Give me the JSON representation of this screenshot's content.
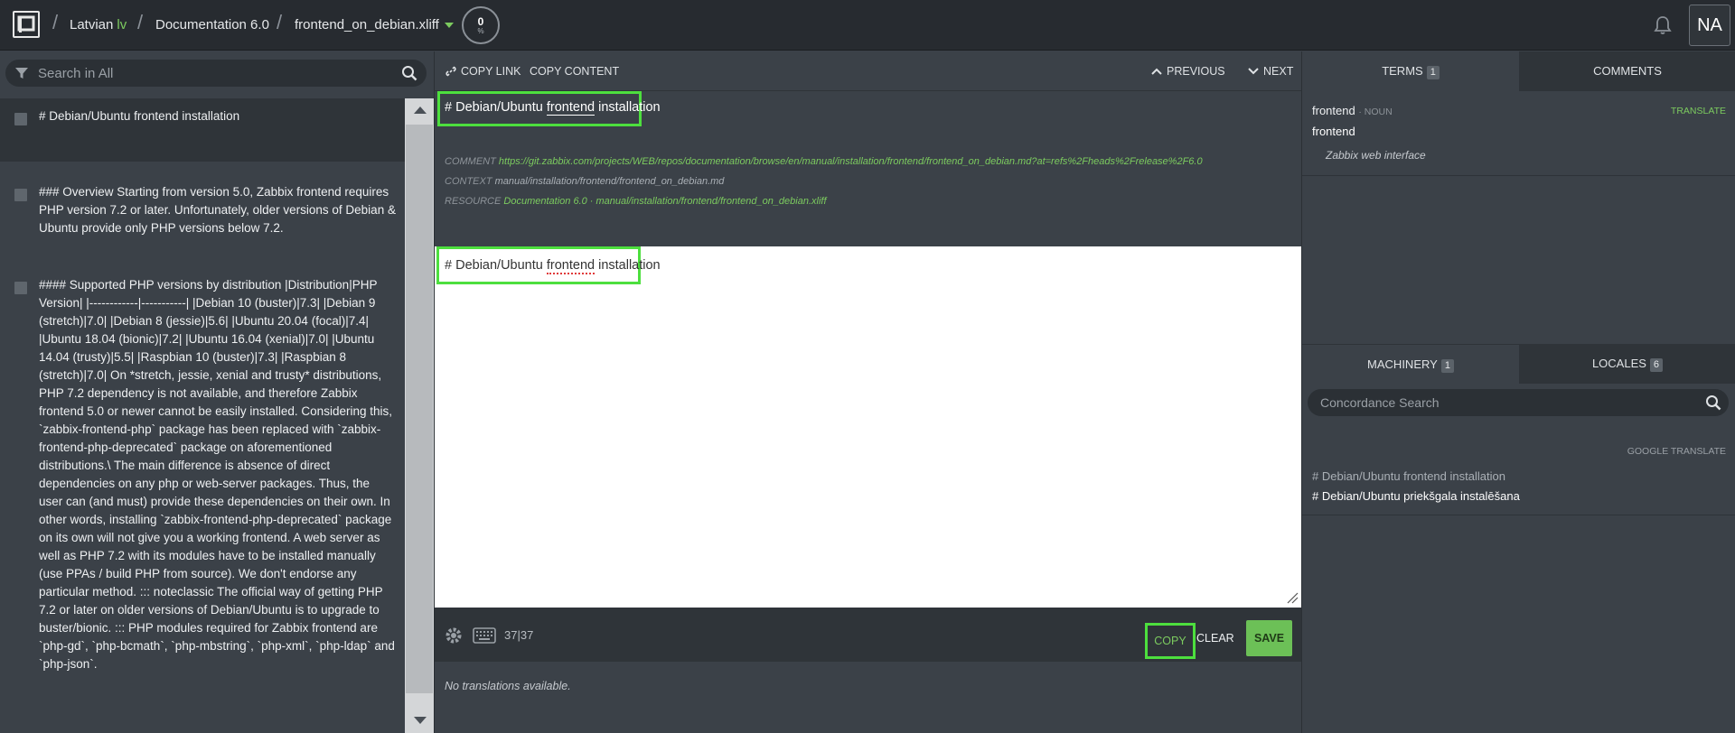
{
  "header": {
    "language_name": "Latvian",
    "language_code": "lv",
    "project": "Documentation 6.0",
    "file": "frontend_on_debian.xliff",
    "progress_value": "0",
    "progress_unit": "%",
    "avatar_initials": "NA"
  },
  "sidebar": {
    "search_placeholder": "Search in All",
    "units": [
      {
        "text": "# Debian/Ubuntu frontend installation",
        "active": true
      },
      {
        "text": "### Overview        Starting from version 5.0, Zabbix frontend requires PHP version 7.2 or      later. Unfortunately, older versions of Debian & Ubuntu provide only PHP      versions below 7.2.",
        "active": false
      },
      {
        "text": "#### Supported PHP versions by distribution      |Distribution|PHP Version|      |------------|-----------|      |Debian 10 (buster)|7.3|      |Debian 9 (stretch)|7.0|      |Debian 8 (jessie)|5.6|      |Ubuntu 20.04 (focal)|7.4|      |Ubuntu 18.04 (bionic)|7.2|      |Ubuntu 16.04 (xenial)|7.0|      |Ubuntu 14.04 (trusty)|5.5|      |Raspbian 10 (buster)|7.3|      |Raspbian 8 (stretch)|7.0|         On *stretch, jessie, xenial and trusty* distributions, PHP 7.2      dependency is not available, and therefore Zabbix frontend 5.0 or newer cannot be easily installed. Considering this, `zabbix-frontend-php`      package has been replaced with `zabbix-frontend-php-deprecated` package      on aforementioned distributions.\\      The main difference is absence of direct dependencies on any php or      web-server packages. Thus, the user can (and must) provide these      dependencies on their own. In other words, installing      `zabbix-frontend-php-deprecated` package on its own will not give you a      working frontend. A web server as well as PHP 7.2 with its modules have      to be installed manually (use PPAs / build PHP from source). We don't      endorse any particular method.        :::      noteclassic      The official way of getting PHP 7.2 or later on older      versions of Debian/Ubuntu is to upgrade to buster/bionic.      :::         PHP modules required for Zabbix frontend are `php-gd`,   `php-bcmath`,      `php-mbstring`, `php-xml`, `php-ldap` and `php-json`.",
        "active": false
      }
    ]
  },
  "editor": {
    "copy_link": "COPY LINK",
    "copy_content": "COPY CONTENT",
    "previous": "PREVIOUS",
    "next": "NEXT",
    "source_text_a": "# Debian/Ubuntu ",
    "source_text_word": "frontend",
    "source_text_b": " installation",
    "comment_label": "COMMENT",
    "comment_value": "https://git.zabbix.com/projects/WEB/repos/documentation/browse/en/manual/installation/frontend/frontend_on_debian.md?at=refs%2Fheads%2Frelease%2F6.0",
    "context_label": "CONTEXT",
    "context_value": "manual/installation/frontend/frontend_on_debian.md",
    "resource_label": "RESOURCE",
    "resource_value": "Documentation 6.0 · manual/installation/frontend/frontend_on_debian.xliff",
    "target_text_a": "# Debian/Ubuntu ",
    "target_text_word": "frontend",
    "target_text_b": " installation",
    "char_count": "37|37",
    "copy_btn": "COPY",
    "clear_btn": "CLEAR",
    "save_btn": "SAVE",
    "no_translations": "No translations available."
  },
  "right_panel": {
    "tabs_top": [
      {
        "label": "TERMS",
        "count": "1"
      },
      {
        "label": "COMMENTS",
        "count": ""
      }
    ],
    "term": {
      "word": "frontend",
      "pos": "NOUN",
      "translate_link": "TRANSLATE",
      "translation": "frontend",
      "comment": "Zabbix web interface"
    },
    "tabs_bottom": [
      {
        "label": "MACHINERY",
        "count": "1"
      },
      {
        "label": "LOCALES",
        "count": "6"
      }
    ],
    "concordance_placeholder": "Concordance Search",
    "machine_provider": "GOOGLE TRANSLATE",
    "mt_source": "# Debian/Ubuntu frontend installation",
    "mt_target": "# Debian/Ubuntu priekšgala instalēšana"
  },
  "colors": {
    "accent_green": "#7ccb5f",
    "highlight_green": "#4ddf3e",
    "save_green": "#6cc057",
    "panel_bg": "#3b4148",
    "topbar_bg": "#272b30"
  }
}
